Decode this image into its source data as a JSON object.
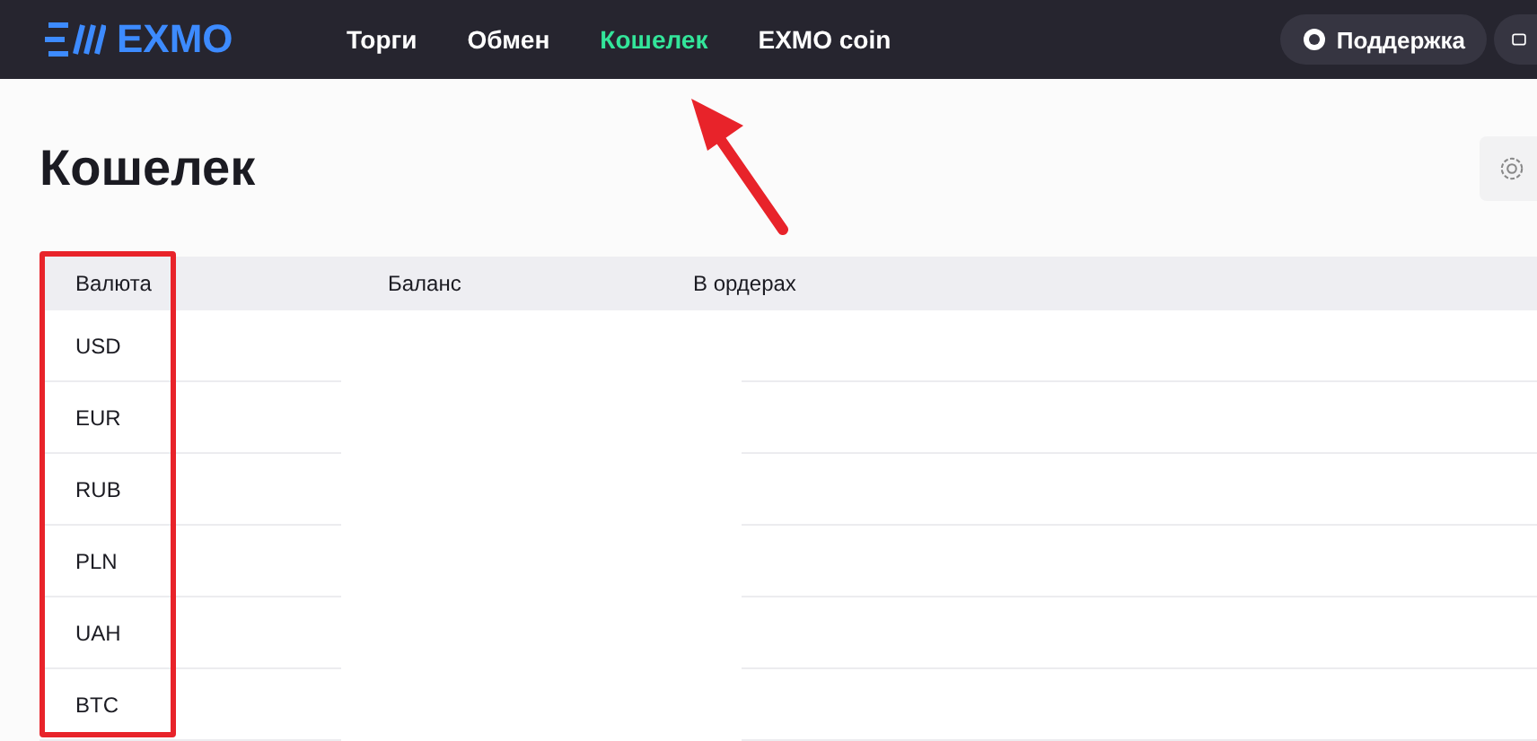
{
  "header": {
    "logo": "EXMO",
    "nav": [
      {
        "label": "Торги",
        "selected": false
      },
      {
        "label": "Обмен",
        "selected": false
      },
      {
        "label": "Кошелек",
        "selected": true
      },
      {
        "label": "EXMO coin",
        "selected": false
      }
    ],
    "support_button": "Поддержка"
  },
  "page_title": "Кошелек",
  "table": {
    "columns": [
      "Валюта",
      "Баланс",
      "В ордерах"
    ],
    "rows": [
      {
        "currency": "USD"
      },
      {
        "currency": "EUR"
      },
      {
        "currency": "RUB"
      },
      {
        "currency": "PLN"
      },
      {
        "currency": "UAH"
      },
      {
        "currency": "BTC"
      }
    ]
  }
}
